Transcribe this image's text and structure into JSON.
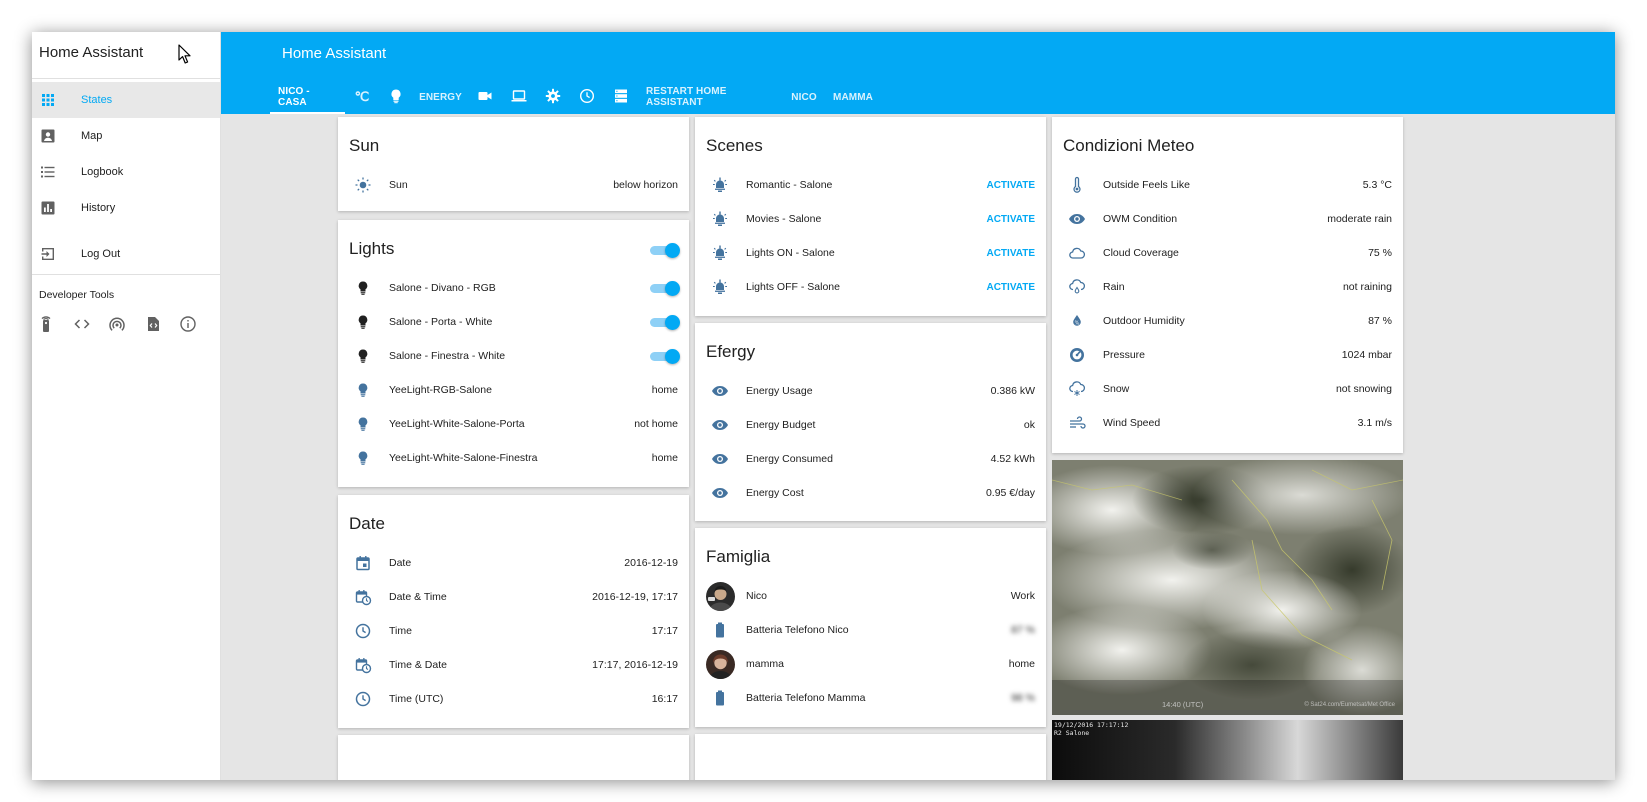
{
  "sidebar": {
    "title": "Home Assistant",
    "items": [
      {
        "label": "States",
        "icon": "grid-icon"
      },
      {
        "label": "Map",
        "icon": "map-pin-icon"
      },
      {
        "label": "Logbook",
        "icon": "list-icon"
      },
      {
        "label": "History",
        "icon": "chart-icon"
      },
      {
        "label": "Log Out",
        "icon": "logout-icon"
      }
    ],
    "dev_title": "Developer Tools"
  },
  "header": {
    "title": "Home Assistant",
    "tabs": [
      {
        "label": "NICO - CASA"
      },
      {
        "label": "℃"
      },
      {
        "label": "",
        "icon": "bulb-icon"
      },
      {
        "label": "ENERGY"
      },
      {
        "label": "",
        "icon": "video-icon"
      },
      {
        "label": "",
        "icon": "laptop-icon"
      },
      {
        "label": "",
        "icon": "gear-icon"
      },
      {
        "label": "",
        "icon": "clock-icon"
      },
      {
        "label": "",
        "icon": "server-icon"
      },
      {
        "label": "RESTART HOME ASSISTANT"
      },
      {
        "label": "NICO"
      },
      {
        "label": "MAMMA"
      }
    ]
  },
  "colors": {
    "accent": "#03a9f4",
    "icon": "#44739e"
  },
  "cards": {
    "sun": {
      "title": "Sun",
      "rows": [
        {
          "name": "Sun",
          "value": "below horizon"
        }
      ]
    },
    "lights": {
      "title": "Lights",
      "rows": [
        {
          "name": "Salone - Divano - RGB",
          "value": ""
        },
        {
          "name": "Salone - Porta - White",
          "value": ""
        },
        {
          "name": "Salone - Finestra - White",
          "value": ""
        },
        {
          "name": "YeeLight-RGB-Salone",
          "value": "home"
        },
        {
          "name": "YeeLight-White-Salone-Porta",
          "value": "not home"
        },
        {
          "name": "YeeLight-White-Salone-Finestra",
          "value": "home"
        }
      ]
    },
    "date": {
      "title": "Date",
      "rows": [
        {
          "name": "Date",
          "value": "2016-12-19"
        },
        {
          "name": "Date & Time",
          "value": "2016-12-19, 17:17"
        },
        {
          "name": "Time",
          "value": "17:17"
        },
        {
          "name": "Time & Date",
          "value": "17:17, 2016-12-19"
        },
        {
          "name": "Time (UTC)",
          "value": "16:17"
        }
      ]
    },
    "scenes": {
      "title": "Scenes",
      "action": "ACTIVATE",
      "rows": [
        {
          "name": "Romantic - Salone"
        },
        {
          "name": "Movies - Salone"
        },
        {
          "name": "Lights ON - Salone"
        },
        {
          "name": "Lights OFF - Salone"
        }
      ]
    },
    "efergy": {
      "title": "Efergy",
      "rows": [
        {
          "name": "Energy Usage",
          "value": "0.386 kW"
        },
        {
          "name": "Energy Budget",
          "value": "ok"
        },
        {
          "name": "Energy Consumed",
          "value": "4.52 kWh"
        },
        {
          "name": "Energy Cost",
          "value": "0.95 €/day"
        }
      ]
    },
    "famiglia": {
      "title": "Famiglia",
      "rows": [
        {
          "name": "Nico",
          "value": "Work"
        },
        {
          "name": "Batteria Telefono Nico",
          "value": "87 %"
        },
        {
          "name": "mamma",
          "value": "home"
        },
        {
          "name": "Batteria Telefono Mamma",
          "value": "98 %"
        }
      ]
    },
    "meteo": {
      "title": "Condizioni Meteo",
      "rows": [
        {
          "name": "Outside Feels Like",
          "value": "5.3 °C"
        },
        {
          "name": "OWM Condition",
          "value": "moderate rain"
        },
        {
          "name": "Cloud Coverage",
          "value": "75 %"
        },
        {
          "name": "Rain",
          "value": "not raining"
        },
        {
          "name": "Outdoor Humidity",
          "value": "87 %"
        },
        {
          "name": "Pressure",
          "value": "1024 mbar"
        },
        {
          "name": "Snow",
          "value": "not snowing"
        },
        {
          "name": "Wind Speed",
          "value": "3.1 m/s"
        }
      ]
    },
    "camera": {
      "timestamp": "14:40 (UTC)",
      "credit": "© Sat24.com/Eumetsat/Met Office",
      "cam2_line1": "19/12/2016 17:17:12",
      "cam2_line2": "R2 Salone"
    }
  }
}
